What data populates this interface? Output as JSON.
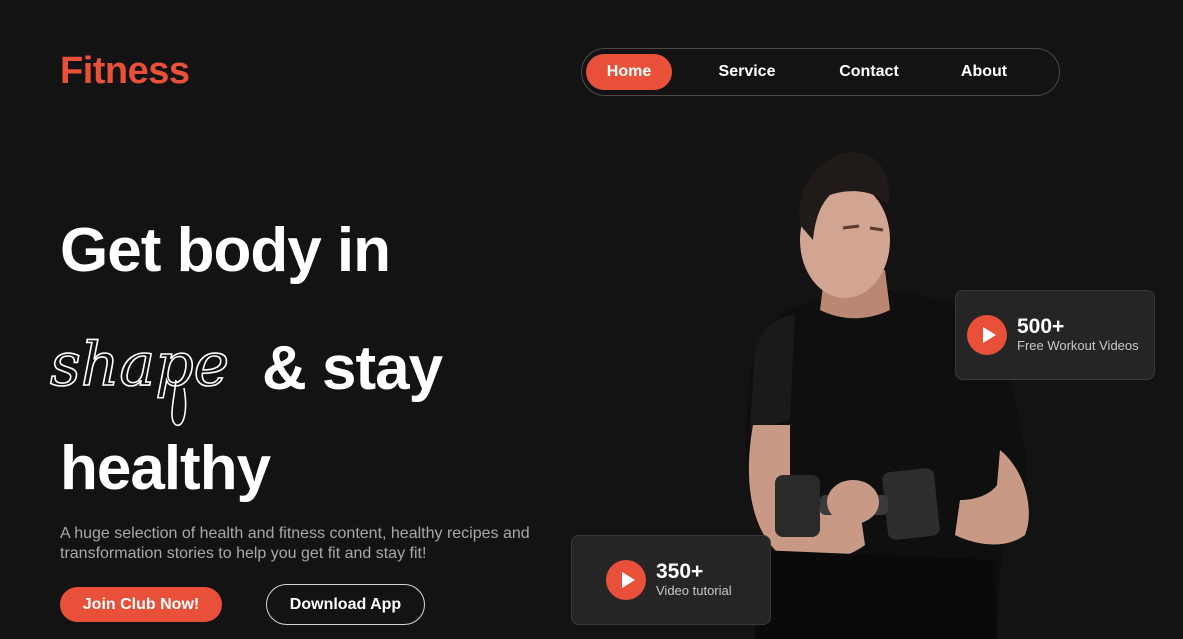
{
  "brand": {
    "name": "Fitness",
    "accent": "#e8503a"
  },
  "nav": {
    "items": [
      {
        "label": "Home",
        "active": true
      },
      {
        "label": "Service",
        "active": false
      },
      {
        "label": "Contact",
        "active": false
      },
      {
        "label": "About",
        "active": false
      }
    ]
  },
  "hero": {
    "line1": "Get body in",
    "script_word": "shape",
    "line2": "& stay",
    "line3": "healthy",
    "description": "A huge selection of health and fitness content, healthy recipes and transformation stories to help you get fit and stay fit!",
    "primary_button": "Join Club Now!",
    "secondary_button": "Download App"
  },
  "stats": [
    {
      "value": "500+",
      "label": "Free Workout Videos",
      "icon": "play-icon"
    },
    {
      "value": "350+",
      "label": "Video tutorial",
      "icon": "play-icon"
    }
  ],
  "image": {
    "subject": "man-with-dumbbell"
  }
}
